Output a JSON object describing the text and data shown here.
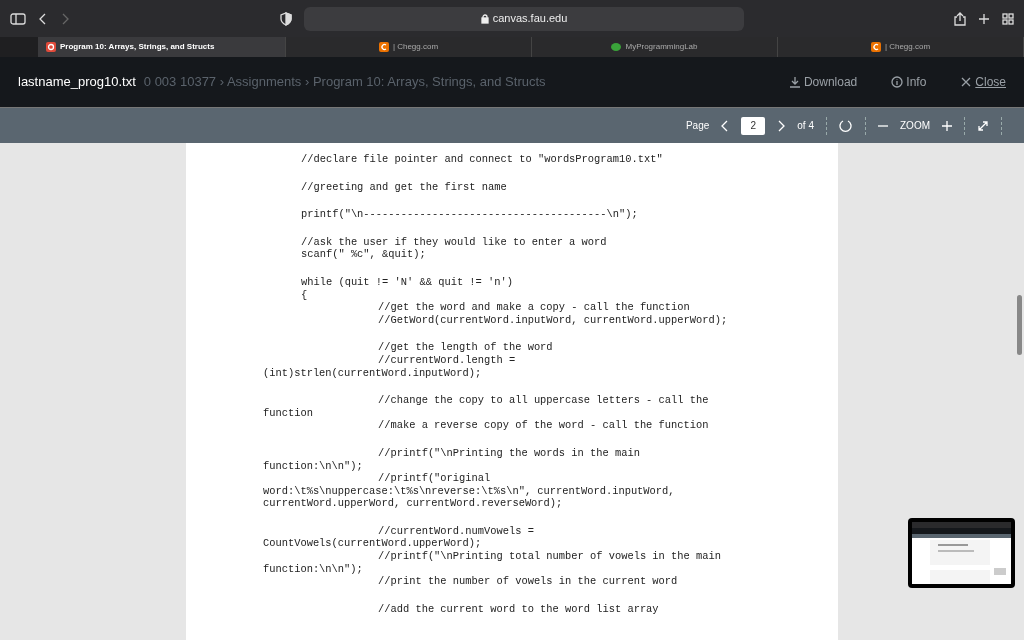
{
  "browser": {
    "address": "canvas.fau.edu",
    "tabs": [
      {
        "label": "Program 10: Arrays, Strings, and Structs",
        "kind": "canvas",
        "selected": true
      },
      {
        "label": "| Chegg.com",
        "kind": "chegg",
        "selected": false
      },
      {
        "label": "MyProgrammingLab",
        "kind": "mpl",
        "selected": false
      },
      {
        "label": "| Chegg.com",
        "kind": "chegg",
        "selected": false
      }
    ]
  },
  "breadcrumb": "0 003 10377  ›  Assignments  ›  Program 10: Arrays, Strings, and Structs",
  "viewer": {
    "filename": "lastname_prog10.txt",
    "actions": [
      {
        "label": "Download",
        "kind": "download"
      },
      {
        "label": "Info",
        "kind": "info"
      },
      {
        "label": "Close",
        "kind": "close"
      }
    ],
    "toolbar": {
      "page_label": "Page",
      "page": "2",
      "of": "of 4",
      "zoom_label": "ZOOM"
    }
  },
  "document": {
    "blocks": [
      [
        {
          "kind": "top",
          "text": "//declare file pointer and connect to \"wordsProgram10.txt\""
        }
      ],
      [
        {
          "kind": "top",
          "text": "//greeting and get the first name"
        }
      ],
      [
        {
          "kind": "top",
          "text": "printf(\"\\n---------------------------------------\\n\");"
        }
      ],
      [
        {
          "kind": "top",
          "text": "//ask the user if they would like to enter a word"
        },
        {
          "kind": "top",
          "text": "scanf(\" %c\", &quit);"
        }
      ],
      [
        {
          "kind": "top",
          "text": "while (quit != 'N' && quit != 'n')"
        },
        {
          "kind": "top",
          "text": "{"
        },
        {
          "kind": "inner",
          "text": "//get the word and make a copy - call the function"
        },
        {
          "kind": "inner",
          "text": "//GetWord(currentWord.inputWord, currentWord.upperWord);"
        }
      ],
      [
        {
          "kind": "inner",
          "text": "//get the length of the word"
        },
        {
          "kind": "inner",
          "text": "//currentWord.length ="
        },
        {
          "kind": "wrap",
          "text": "(int)strlen(currentWord.inputWord);"
        }
      ],
      [
        {
          "kind": "inner",
          "text": "//change the copy to all uppercase letters - call the"
        },
        {
          "kind": "wrap",
          "text": "function"
        },
        {
          "kind": "inner",
          "text": "//make a reverse copy of the word - call the function"
        }
      ],
      [
        {
          "kind": "inner",
          "text": "//printf(\"\\nPrinting the words in the main"
        },
        {
          "kind": "wrap",
          "text": "function:\\n\\n\");"
        },
        {
          "kind": "inner",
          "text": "//printf(\"original"
        },
        {
          "kind": "wrap",
          "text": "word:\\t%s\\nuppercase:\\t%s\\nreverse:\\t%s\\n\", currentWord.inputWord,"
        },
        {
          "kind": "wrap",
          "text": "currentWord.upperWord, currentWord.reverseWord);"
        }
      ],
      [
        {
          "kind": "inner",
          "text": "//currentWord.numVowels ="
        },
        {
          "kind": "wrap",
          "text": "CountVowels(currentWord.upperWord);"
        },
        {
          "kind": "inner",
          "text": "//printf(\"\\nPrinting total number of vowels in the main"
        },
        {
          "kind": "wrap",
          "text": "function:\\n\\n\");"
        },
        {
          "kind": "inner",
          "text": "//print the number of vowels in the current word"
        }
      ],
      [
        {
          "kind": "inner",
          "text": "//add the current word to the word list array"
        }
      ]
    ]
  }
}
